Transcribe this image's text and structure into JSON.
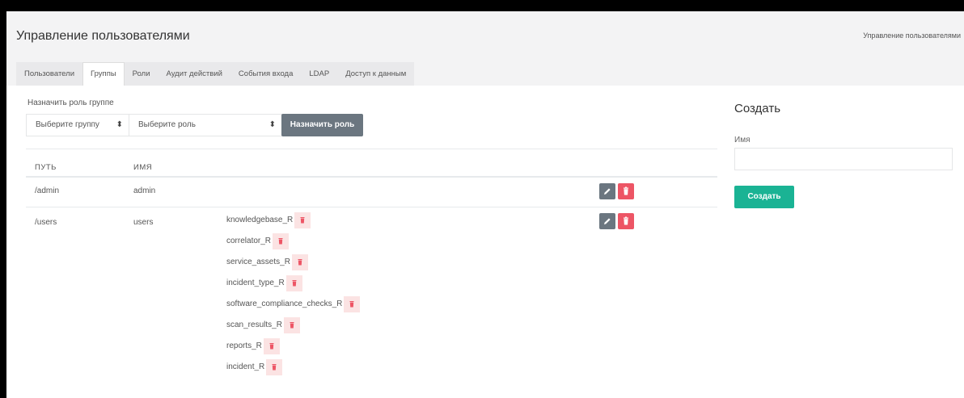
{
  "header": {
    "title": "Управление пользователями",
    "breadcrumb": "Управление пользователями"
  },
  "tabs": [
    {
      "label": "Пользователи",
      "active": false
    },
    {
      "label": "Группы",
      "active": true
    },
    {
      "label": "Роли",
      "active": false
    },
    {
      "label": "Аудит действий",
      "active": false
    },
    {
      "label": "События входа",
      "active": false
    },
    {
      "label": "LDAP",
      "active": false
    },
    {
      "label": "Доступ к данным",
      "active": false
    }
  ],
  "assign": {
    "label": "Назначить роль группе",
    "group_select": "Выберите группу",
    "role_select": "Выберите роль",
    "button": "Назначить роль"
  },
  "table": {
    "headers": {
      "path": "ПУТЬ",
      "name": "ИМЯ"
    },
    "rows": [
      {
        "path": "/admin",
        "name": "admin",
        "roles": []
      },
      {
        "path": "/users",
        "name": "users",
        "roles": [
          "knowledgebase_R",
          "correlator_R",
          "service_assets_R",
          "incident_type_R",
          "software_compliance_checks_R",
          "scan_results_R",
          "reports_R",
          "incident_R"
        ]
      }
    ]
  },
  "create": {
    "title": "Создать",
    "name_label": "Имя",
    "name_value": "",
    "button": "Создать"
  },
  "icons": {
    "edit": "pencil-icon",
    "delete": "trash-icon",
    "caret": "sort-caret-icon"
  },
  "colors": {
    "primary": "#1ab394",
    "danger": "#ed5565",
    "secondary": "#6b7680"
  }
}
